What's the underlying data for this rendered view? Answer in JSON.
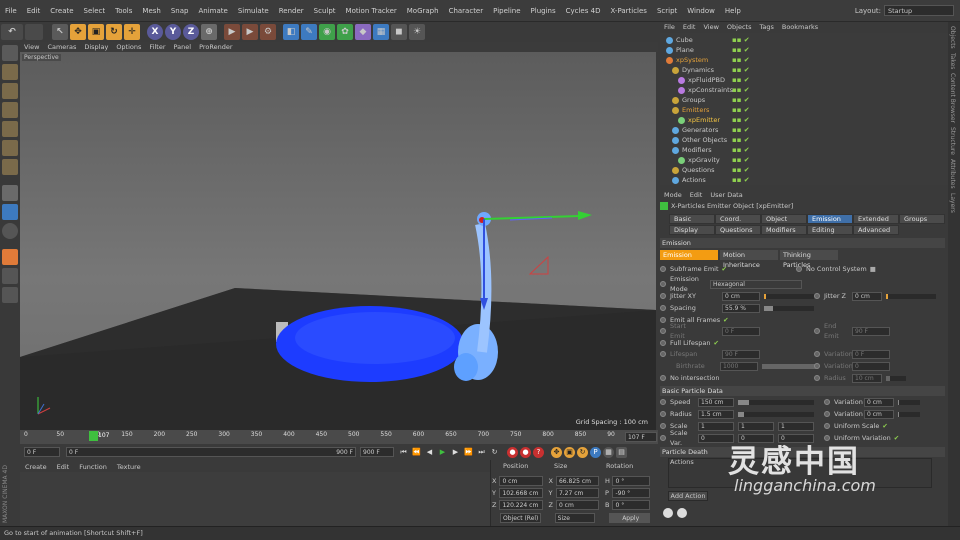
{
  "menubar": {
    "items": [
      "File",
      "Edit",
      "Create",
      "Select",
      "Tools",
      "Mesh",
      "Snap",
      "Animate",
      "Simulate",
      "Render",
      "Sculpt",
      "Motion Tracker",
      "MoGraph",
      "Character",
      "Pipeline",
      "Plugins",
      "Cycles 4D",
      "X-Particles",
      "Script",
      "Window",
      "Help"
    ],
    "layout_label": "Layout:",
    "layout_value": "Startup"
  },
  "toolbar": {
    "axis_x": "X",
    "axis_y": "Y",
    "axis_z": "Z"
  },
  "viewport": {
    "menu": [
      "View",
      "Cameras",
      "Display",
      "Options",
      "Filter",
      "Panel",
      "ProRender"
    ],
    "camera": "Perspective",
    "grid_spacing": "Grid Spacing : 100 cm"
  },
  "timeline": {
    "ticks": [
      "0",
      "50",
      "100",
      "150",
      "200",
      "250",
      "300",
      "350",
      "400",
      "450",
      "500",
      "550",
      "600",
      "650",
      "700",
      "750",
      "800",
      "850",
      "90"
    ],
    "current": "107",
    "end_label": "107 F"
  },
  "transport": {
    "start": "0 F",
    "range_start": "0 F",
    "range_end": "900 F",
    "end": "900 F"
  },
  "materials": {
    "menu": [
      "Create",
      "Edit",
      "Function",
      "Texture"
    ],
    "maxon": "MAXON CINEMA 4D"
  },
  "coordinates": {
    "headers": [
      "Position",
      "Size",
      "Rotation"
    ],
    "rows": [
      {
        "pa": "X",
        "pv": "0 cm",
        "sa": "X",
        "sv": "66.825 cm",
        "ra": "H",
        "rv": "0 °"
      },
      {
        "pa": "Y",
        "pv": "102.668 cm",
        "sa": "Y",
        "sv": "7.27 cm",
        "ra": "P",
        "rv": "-90 °"
      },
      {
        "pa": "Z",
        "pv": "120.224 cm",
        "sa": "Z",
        "sv": "0 cm",
        "ra": "B",
        "rv": "0 °"
      }
    ],
    "mode": "Object (Rel)",
    "size_mode": "Size",
    "apply": "Apply"
  },
  "status": "Go to start of animation [Shortcut Shift+F]",
  "object_manager": {
    "menu": [
      "File",
      "Edit",
      "View",
      "Objects",
      "Tags",
      "Bookmarks"
    ],
    "items": [
      {
        "name": "Cube",
        "color": "#5fa8e0",
        "indent": 0
      },
      {
        "name": "Plane",
        "color": "#5fa8e0",
        "indent": 0
      },
      {
        "name": "xpSystem",
        "color": "#e07b39",
        "indent": 0
      },
      {
        "name": "Dynamics",
        "color": "#c9a43a",
        "indent": 1
      },
      {
        "name": "xpFluidPBD",
        "color": "#b87ae0",
        "indent": 2
      },
      {
        "name": "xpConstraints",
        "color": "#b87ae0",
        "indent": 2
      },
      {
        "name": "Groups",
        "color": "#c9a43a",
        "indent": 1
      },
      {
        "name": "Emitters",
        "color": "#c9a43a",
        "indent": 1
      },
      {
        "name": "xpEmitter",
        "color": "#7ad07a",
        "indent": 2
      },
      {
        "name": "Generators",
        "color": "#5fa8e0",
        "indent": 1
      },
      {
        "name": "Other Objects",
        "color": "#5fa8e0",
        "indent": 1
      },
      {
        "name": "Modifiers",
        "color": "#5fa8e0",
        "indent": 1
      },
      {
        "name": "xpGravity",
        "color": "#7ad07a",
        "indent": 2
      },
      {
        "name": "Questions",
        "color": "#c9a43a",
        "indent": 1
      },
      {
        "name": "Actions",
        "color": "#5fa8e0",
        "indent": 1
      }
    ]
  },
  "attributes": {
    "menu": [
      "Mode",
      "Edit",
      "User Data"
    ],
    "title": "X-Particles Emitter Object [xpEmitter]",
    "tabs_row1": [
      "Basic",
      "Coord.",
      "Object",
      "Emission",
      "Extended Data",
      "Groups"
    ],
    "tabs_row2": [
      "Display",
      "Questions",
      "Modifiers",
      "Editing",
      "Advanced"
    ],
    "section_emission": "Emission",
    "subtabs": [
      "Emission",
      "Motion Inheritance",
      "Thinking Particles"
    ],
    "subframe_emit": "Subframe Emit",
    "no_control": "No Control System",
    "emission_mode_label": "Emission Mode",
    "emission_mode_value": "Hexagonal",
    "jitter_xy_label": "Jitter XY",
    "jitter_xy": "0 cm",
    "jitter_z_label": "Jitter Z",
    "jitter_z": "0 cm",
    "spacing_label": "Spacing",
    "spacing": "55.9 %",
    "emit_all": "Emit all Frames",
    "start_emit_label": "Start Emit",
    "start_emit": "0 F",
    "end_emit_label": "End Emit",
    "end_emit": "90 F",
    "full_lifespan": "Full Lifespan",
    "lifespan_label": "Lifespan",
    "lifespan": "90 F",
    "variation_label": "Variation",
    "lifespan_var": "0 F",
    "birthrate_label": "Birthrate",
    "birthrate": "1000",
    "birthrate_var": "0",
    "no_intersection": "No intersection",
    "radius_label": "Radius",
    "radius_small": "10 cm",
    "section_basic": "Basic Particle Data",
    "speed_label": "Speed",
    "speed": "150 cm",
    "speed_var": "0 cm",
    "radius": "1.5 cm",
    "radius_var": "0 cm",
    "scale_label": "Scale",
    "scale": [
      "1",
      "1",
      "1"
    ],
    "uniform_scale": "Uniform Scale",
    "scale_var_label": "Scale Var.",
    "scale_var": [
      "0",
      "0",
      "0"
    ],
    "uniform_variation": "Uniform Variation",
    "section_death": "Particle Death",
    "actions_label": "Actions",
    "add_action": "Add Action"
  },
  "right_tabs": [
    "Objects",
    "Takes",
    "Content Browser",
    "Structure",
    "Attributes",
    "Layers"
  ],
  "watermark": {
    "cn": "灵感中国",
    "url": "lingganchina.com"
  },
  "colors": {
    "accent_blue": "#3f6fa8",
    "accent_orange": "#f39c12",
    "particles": "#1d3cff",
    "check_green": "#8fd14f"
  }
}
